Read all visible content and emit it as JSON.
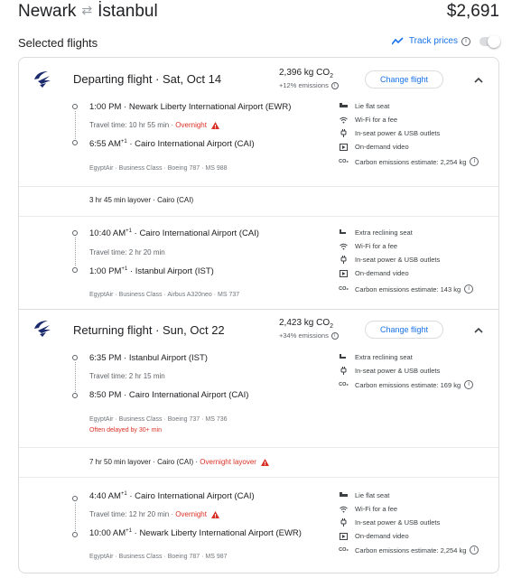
{
  "header": {
    "origin": "Newark",
    "swap_icon": "swap-arrows-icon",
    "destination": "İstanbul",
    "price": "$2,691"
  },
  "selected_title": "Selected flights",
  "track": {
    "label": "Track prices",
    "enabled": false
  },
  "departing": {
    "title": "Departing flight",
    "date": "Sat, Oct 14",
    "co2": "2,396 kg CO",
    "co2_sub": "2",
    "emissions": "+12% emissions",
    "change": "Change flight",
    "seg1": {
      "dep_time": "1:00 PM",
      "dep_airport": "Newark Liberty International Airport (EWR)",
      "travel": "Travel time: 10 hr 55 min",
      "overnight": "Overnight",
      "arr_time": "6:55 AM",
      "arr_plus": "+1",
      "arr_airport": "Cairo International Airport (CAI)",
      "meta": "EgyptAir · Business Class · Boeing 787 · MS 988",
      "amenities": [
        "Lie flat seat",
        "Wi-Fi for a fee",
        "In-seat power & USB outlets",
        "On-demand video",
        "Carbon emissions estimate: 2,254 kg"
      ]
    },
    "layover": "3 hr 45 min layover · Cairo (CAI)",
    "seg2": {
      "dep_time": "10:40 AM",
      "dep_plus": "+1",
      "dep_airport": "Cairo International Airport (CAI)",
      "travel": "Travel time: 2 hr 20 min",
      "arr_time": "1:00 PM",
      "arr_plus": "+1",
      "arr_airport": "Istanbul Airport (IST)",
      "meta": "EgyptAir · Business Class · Airbus A320neo · MS 737",
      "amenities": [
        "Extra reclining seat",
        "Wi-Fi for a fee",
        "In-seat power & USB outlets",
        "On-demand video",
        "Carbon emissions estimate: 143 kg"
      ]
    }
  },
  "returning": {
    "title": "Returning flight",
    "date": "Sun, Oct 22",
    "co2": "2,423 kg CO",
    "co2_sub": "2",
    "emissions": "+34% emissions",
    "change": "Change flight",
    "seg1": {
      "dep_time": "6:35 PM",
      "dep_airport": "Istanbul Airport (IST)",
      "travel": "Travel time: 2 hr 15 min",
      "arr_time": "8:50 PM",
      "arr_airport": "Cairo International Airport (CAI)",
      "meta": "EgyptAir · Business Class · Boeing 737 · MS 736",
      "delay": "Often delayed by 30+ min",
      "amenities": [
        "Extra reclining seat",
        "In-seat power & USB outlets",
        "Carbon emissions estimate: 169 kg"
      ]
    },
    "layover": "7 hr 50 min layover · Cairo (CAI) ·",
    "layover_overnight": "Overnight layover",
    "seg2": {
      "dep_time": "4:40 AM",
      "dep_plus": "+1",
      "dep_airport": "Cairo International Airport (CAI)",
      "travel": "Travel time: 12 hr 20 min",
      "overnight": "Overnight",
      "arr_time": "10:00 AM",
      "arr_plus": "+1",
      "arr_airport": "Newark Liberty International Airport (EWR)",
      "meta": "EgyptAir · Business Class · Boeing 787 · MS 987",
      "amenities": [
        "Lie flat seat",
        "Wi-Fi for a fee",
        "In-seat power & USB outlets",
        "On-demand video",
        "Carbon emissions estimate: 2,254 kg"
      ]
    }
  },
  "colors": {
    "accent": "#1a73e8",
    "warning": "#d93025",
    "text": "#202124",
    "muted": "#5f6368",
    "airline": "#1c2b6b"
  },
  "icons": [
    "swap-arrows-icon",
    "trend-chart-icon",
    "info-icon",
    "egyptair-logo-icon",
    "chevron-up-icon",
    "warning-icon",
    "seat-icon",
    "wifi-icon",
    "power-plug-icon",
    "video-icon",
    "co2-icon"
  ]
}
